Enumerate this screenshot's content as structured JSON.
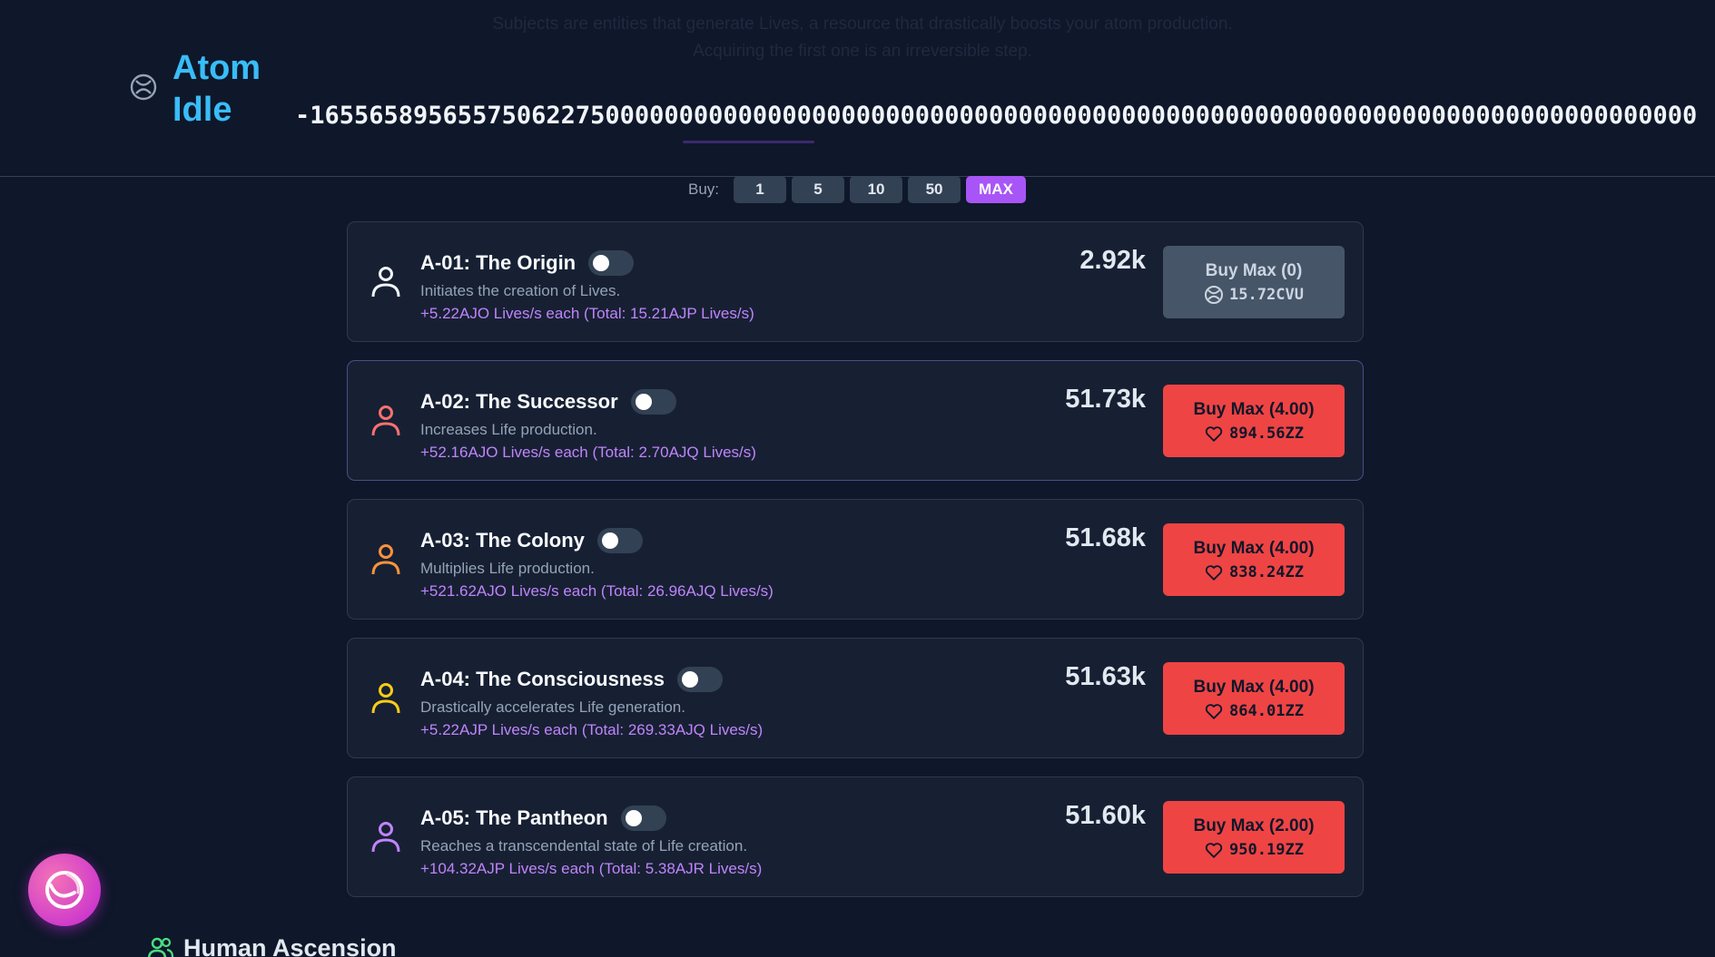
{
  "header": {
    "ghost_text": "Subjects are entities that generate Lives, a resource that drastically boosts your atom production. Acquiring the first one is an irreversible step.",
    "app_title": "Atom Idle",
    "counter": "-1655658956557506227500000000000000000000000000000000000000000000000000000000000000000000000000"
  },
  "buy_selector": {
    "label": "Buy:",
    "options": [
      "1",
      "5",
      "10",
      "50",
      "MAX"
    ],
    "selected": "MAX"
  },
  "generators": [
    {
      "title": "A-01: The Origin",
      "description": "Initiates the creation of Lives.",
      "rate": "+5.22AJO Lives/s each (Total: 15.21AJP Lives/s)",
      "count": "2.92k",
      "button_label": "Buy Max (0)",
      "cost": "15.72CVU",
      "cost_icon": "atom-icon",
      "icon_color": "#f1f5f9",
      "enabled": false
    },
    {
      "title": "A-02: The Successor",
      "description": "Increases Life production.",
      "rate": "+52.16AJO Lives/s each (Total: 2.70AJQ Lives/s)",
      "count": "51.73k",
      "button_label": "Buy Max (4.00)",
      "cost": "894.56ZZ",
      "cost_icon": "heart-icon",
      "icon_color": "#f87171",
      "enabled": true
    },
    {
      "title": "A-03: The Colony",
      "description": "Multiplies Life production.",
      "rate": "+521.62AJO Lives/s each (Total: 26.96AJQ Lives/s)",
      "count": "51.68k",
      "button_label": "Buy Max (4.00)",
      "cost": "838.24ZZ",
      "cost_icon": "heart-icon",
      "icon_color": "#fb923c",
      "enabled": true
    },
    {
      "title": "A-04: The Consciousness",
      "description": "Drastically accelerates Life generation.",
      "rate": "+5.22AJP Lives/s each (Total: 269.33AJQ Lives/s)",
      "count": "51.63k",
      "button_label": "Buy Max (4.00)",
      "cost": "864.01ZZ",
      "cost_icon": "heart-icon",
      "icon_color": "#facc15",
      "enabled": true
    },
    {
      "title": "A-05: The Pantheon",
      "description": "Reaches a transcendental state of Life creation.",
      "rate": "+104.32AJP Lives/s each (Total: 5.38AJR Lives/s)",
      "count": "51.60k",
      "button_label": "Buy Max (2.00)",
      "cost": "950.19ZZ",
      "cost_icon": "heart-icon",
      "icon_color": "#c084fc",
      "enabled": true
    }
  ],
  "fab": {
    "icon": "swirl-icon"
  },
  "next_section": {
    "title": "Human Ascension",
    "icon": "users-icon"
  },
  "colors": {
    "background": "#0f172a",
    "card": "#172033",
    "accent": "#a855f7",
    "buy_enabled": "#ef4444",
    "buy_disabled": "#475569",
    "title": "#38bdf8",
    "rate_text": "#c084fc"
  }
}
